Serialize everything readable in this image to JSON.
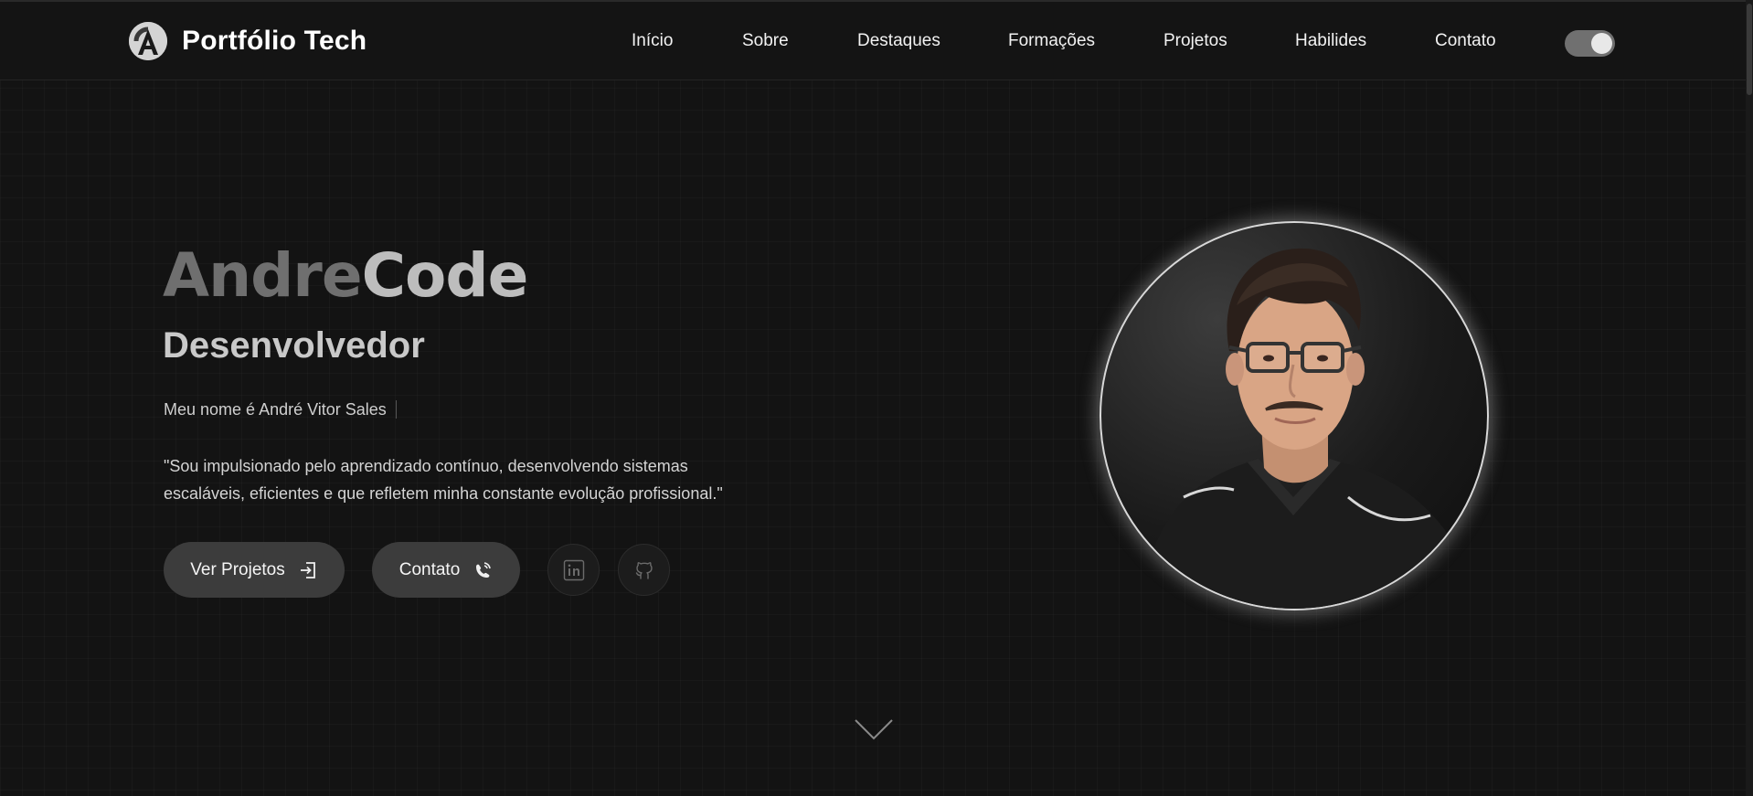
{
  "header": {
    "brand_letter": "A",
    "brand_title": "Portfólio Tech",
    "nav": [
      {
        "label": "Início"
      },
      {
        "label": "Sobre"
      },
      {
        "label": "Destaques"
      },
      {
        "label": "Formações"
      },
      {
        "label": "Projetos"
      },
      {
        "label": "Habilides"
      },
      {
        "label": "Contato"
      }
    ],
    "theme_toggle_on": true
  },
  "hero": {
    "name_part1": "Andre",
    "name_part2": "Code",
    "role": "Desenvolvedor",
    "intro": "Meu nome é André Vitor Sales",
    "quote": "\"Sou impulsionado pelo aprendizado contínuo, desenvolvendo sistemas escaláveis, eficientes e que refletem minha constante evolução profissional.\"",
    "buttons": {
      "projects_label": "Ver Projetos",
      "contact_label": "Contato"
    },
    "social": [
      {
        "icon": "linkedin-icon"
      },
      {
        "icon": "github-icon"
      }
    ]
  },
  "colors": {
    "background": "#131313",
    "header_bg": "#141414",
    "button_bg": "#3c3c3c",
    "name_dim": "#6f6f6f",
    "name_light": "#bdbdbd",
    "toggle_bg": "#707070"
  }
}
